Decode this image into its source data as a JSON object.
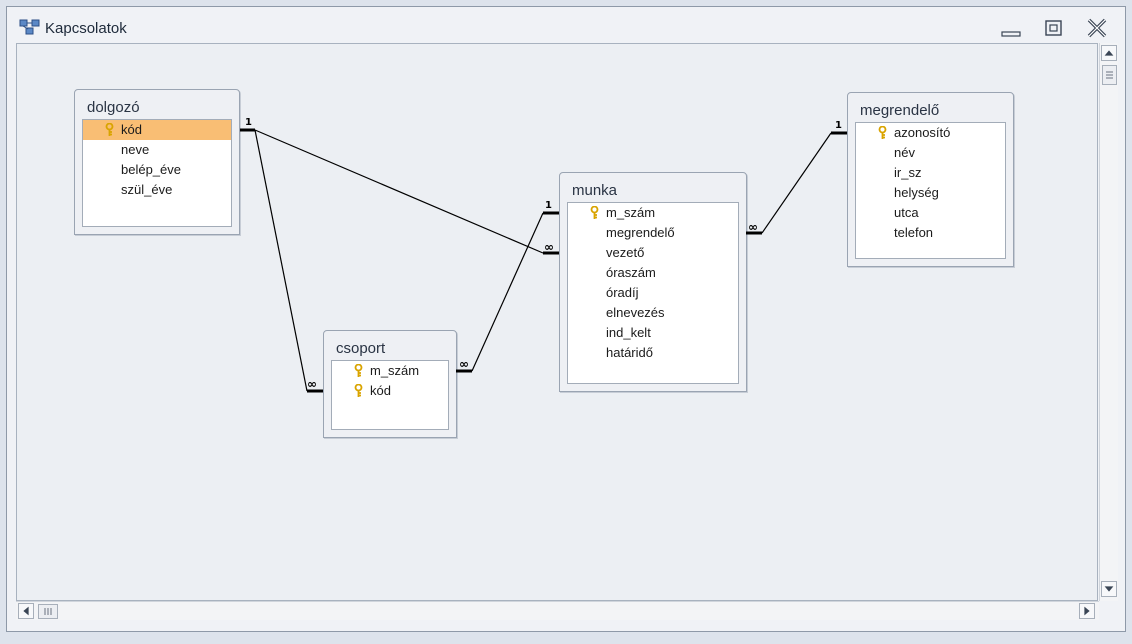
{
  "window": {
    "title": "Kapcsolatok",
    "icon": "relationships-icon"
  },
  "tables": {
    "dolgozo": {
      "title": "dolgozó",
      "fields": [
        {
          "name": "kód",
          "key": true,
          "selected": true
        },
        {
          "name": "neve"
        },
        {
          "name": "belép_éve"
        },
        {
          "name": "szül_éve"
        }
      ]
    },
    "csoport": {
      "title": "csoport",
      "fields": [
        {
          "name": "m_szám",
          "key": true
        },
        {
          "name": "kód",
          "key": true
        }
      ]
    },
    "munka": {
      "title": "munka",
      "fields": [
        {
          "name": "m_szám",
          "key": true
        },
        {
          "name": "megrendelő"
        },
        {
          "name": "vezető"
        },
        {
          "name": "óraszám"
        },
        {
          "name": "óradíj"
        },
        {
          "name": "elnevezés"
        },
        {
          "name": "ind_kelt"
        },
        {
          "name": "határidő"
        }
      ]
    },
    "megrendelo": {
      "title": "megrendelő",
      "fields": [
        {
          "name": "azonosító",
          "key": true
        },
        {
          "name": "név"
        },
        {
          "name": "ir_sz"
        },
        {
          "name": "helység"
        },
        {
          "name": "utca"
        },
        {
          "name": "telefon"
        }
      ]
    }
  },
  "relationships": [
    {
      "from": "dolgozó.kód",
      "to": "munka.vezető",
      "one_label": "1",
      "many_label": "∞"
    },
    {
      "from": "dolgozó.kód",
      "to": "csoport.kód",
      "one_label": "1",
      "many_label": "∞"
    },
    {
      "from": "munka.m_szám",
      "to": "csoport.m_szám",
      "one_label": "1",
      "many_label": "∞"
    },
    {
      "from": "megrendelő.azonosító",
      "to": "munka.megrendelő",
      "one_label": "1",
      "many_label": "∞"
    }
  ],
  "colors": {
    "selected_field": "#f9be74",
    "key_icon": "#d9a400",
    "line": "#000000"
  }
}
